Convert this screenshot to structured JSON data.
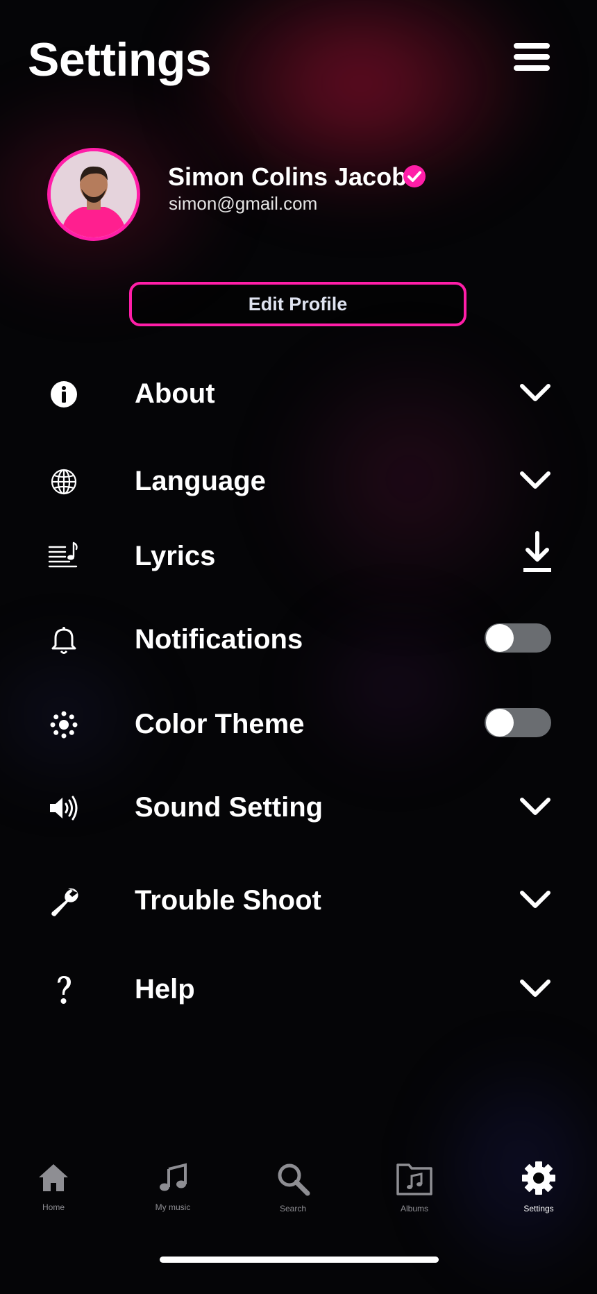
{
  "header": {
    "title": "Settings",
    "menu_icon": "hamburger-menu-icon"
  },
  "profile": {
    "name": "Simon Colins Jacob",
    "email": "simon@gmail.com",
    "verified_icon": "verified-check-icon",
    "edit_label": "Edit Profile",
    "accent_color": "#ff1ea8"
  },
  "settings": [
    {
      "label": "About",
      "icon": "info-icon",
      "control": "chevron-down-icon"
    },
    {
      "label": "Language",
      "icon": "globe-icon",
      "control": "chevron-down-icon"
    },
    {
      "label": "Lyrics",
      "icon": "lyrics-icon",
      "control": "download-icon"
    },
    {
      "label": "Notifications",
      "icon": "bell-icon",
      "control": "toggle",
      "enabled": false
    },
    {
      "label": "Color Theme",
      "icon": "brightness-icon",
      "control": "toggle",
      "enabled": false
    },
    {
      "label": "Sound Setting",
      "icon": "speaker-icon",
      "control": "chevron-down-icon"
    },
    {
      "label": "Trouble Shoot",
      "icon": "wrench-icon",
      "control": "chevron-down-icon"
    },
    {
      "label": "Help",
      "icon": "question-icon",
      "control": "chevron-down-icon"
    }
  ],
  "tabs": [
    {
      "label": "Home",
      "icon": "home-icon",
      "active": false
    },
    {
      "label": "My music",
      "icon": "music-note-icon",
      "active": false
    },
    {
      "label": "Search",
      "icon": "search-icon",
      "active": false
    },
    {
      "label": "Albums",
      "icon": "album-folder-icon",
      "active": false
    },
    {
      "label": "Settings",
      "icon": "gear-icon",
      "active": true
    }
  ]
}
